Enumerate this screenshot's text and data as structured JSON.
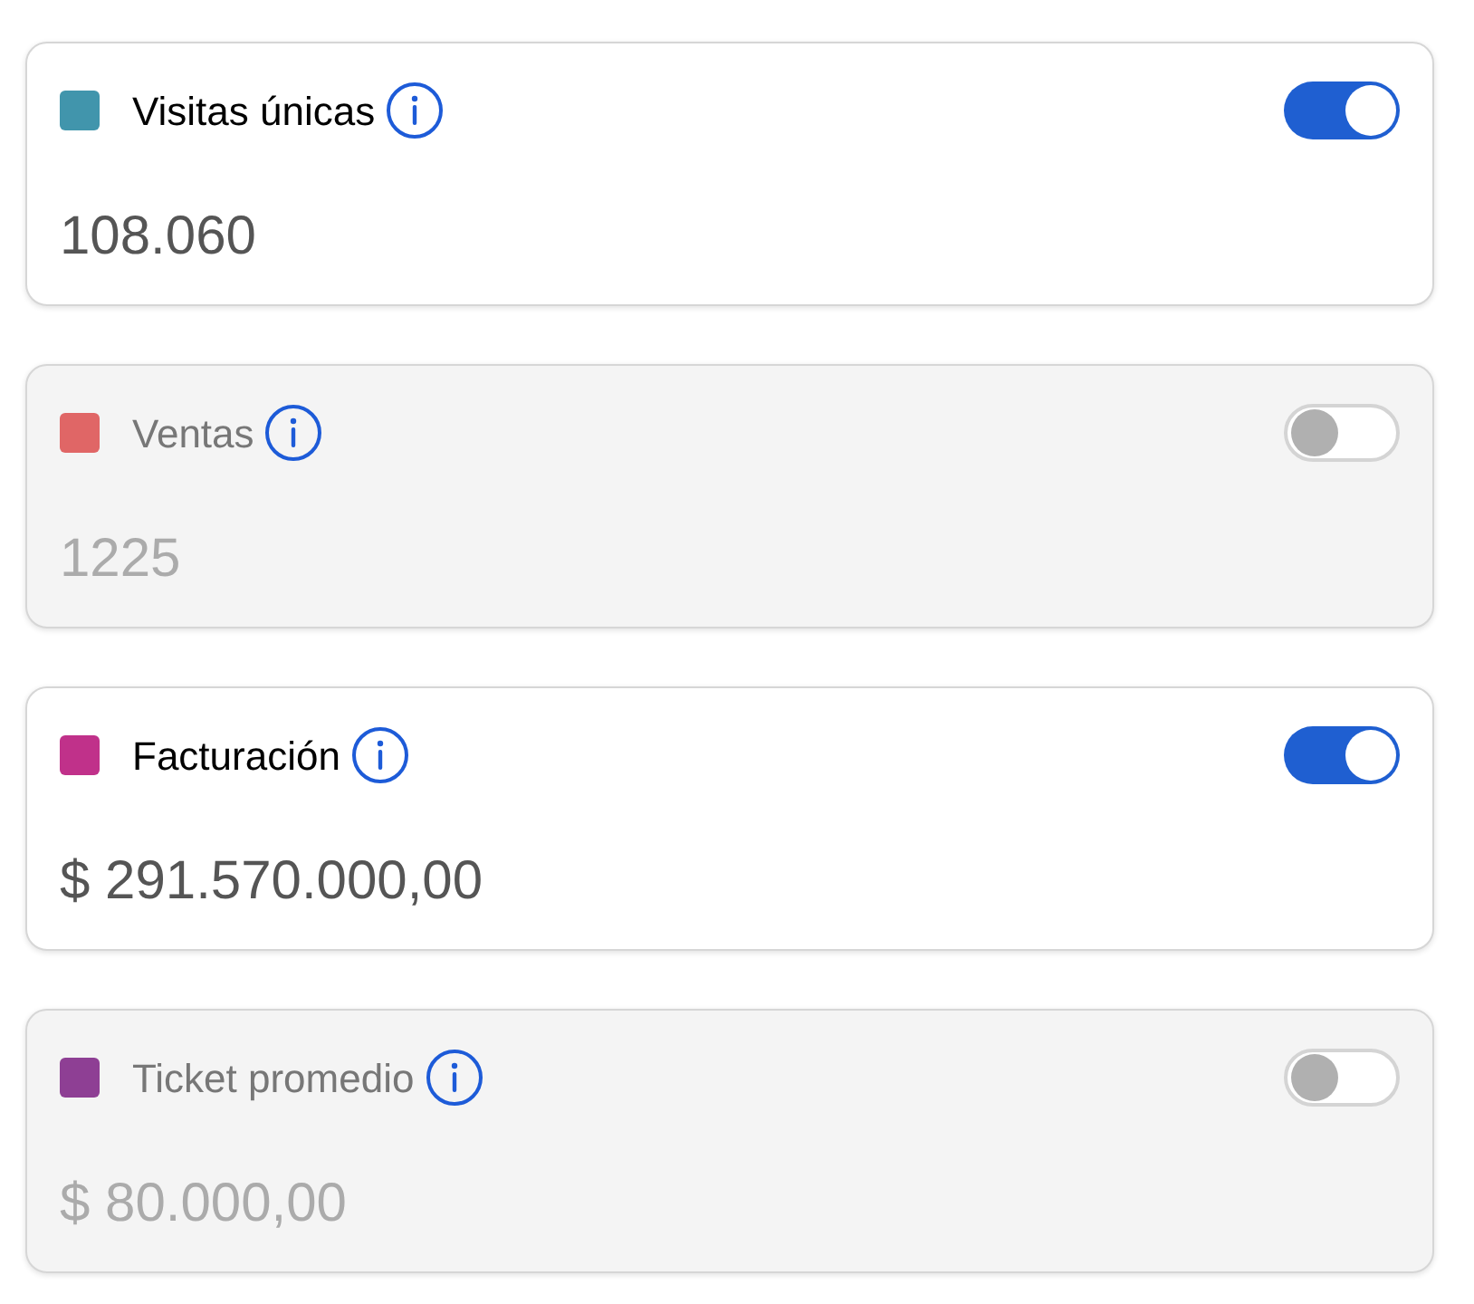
{
  "metrics": [
    {
      "label": "Visitas únicas",
      "value": "108.060",
      "color": "#4195ac",
      "on": true
    },
    {
      "label": "Ventas",
      "value": "1225",
      "color": "#e06666",
      "on": false
    },
    {
      "label": "Facturación",
      "value": "$ 291.570.000,00",
      "color": "#c0318a",
      "on": true
    },
    {
      "label": "Ticket promedio",
      "value": "$ 80.000,00",
      "color": "#8e3f94",
      "on": false
    }
  ]
}
